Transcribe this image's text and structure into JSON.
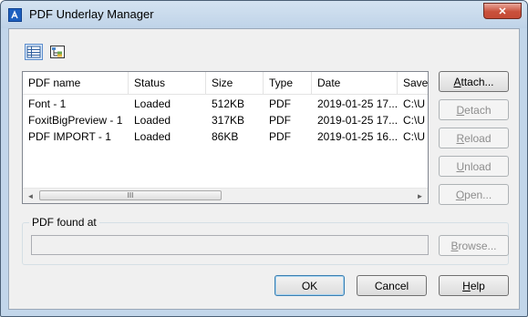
{
  "window": {
    "title": "PDF Underlay Manager",
    "close_symbol": "✕"
  },
  "toolbar": {
    "list_view_icon": "list-view-icon",
    "tree_view_icon": "tree-view-icon"
  },
  "table": {
    "columns": [
      "PDF name",
      "Status",
      "Size",
      "Type",
      "Date",
      "Save"
    ],
    "rows": [
      [
        "Font - 1",
        "Loaded",
        "512KB",
        "PDF",
        "2019-01-25 17...",
        "C:\\U"
      ],
      [
        "FoxitBigPreview - 1",
        "Loaded",
        "317KB",
        "PDF",
        "2019-01-25 17...",
        "C:\\U"
      ],
      [
        "PDF IMPORT - 1",
        "Loaded",
        "86KB",
        "PDF",
        "2019-01-25 16...",
        "C:\\U"
      ]
    ],
    "scroll_left": "◄",
    "scroll_right": "►",
    "scroll_thumb_grip": "III"
  },
  "side_buttons": {
    "attach": {
      "pre": "",
      "acc": "A",
      "post": "ttach..."
    },
    "detach": {
      "pre": "",
      "acc": "D",
      "post": "etach"
    },
    "reload": {
      "pre": "",
      "acc": "R",
      "post": "eload"
    },
    "unload": {
      "pre": "",
      "acc": "U",
      "post": "nload"
    },
    "open": {
      "pre": "",
      "acc": "O",
      "post": "pen..."
    }
  },
  "found_at": {
    "label": "PDF found at",
    "value": ""
  },
  "browse": {
    "pre": "",
    "acc": "B",
    "post": "rowse..."
  },
  "footer": {
    "ok": "OK",
    "cancel": "Cancel",
    "help": {
      "pre": "",
      "acc": "H",
      "post": "elp"
    }
  },
  "colors": {
    "titlebar": "#c2d6ea",
    "client": "#f0f0f0",
    "close_button": "#c9503b"
  }
}
